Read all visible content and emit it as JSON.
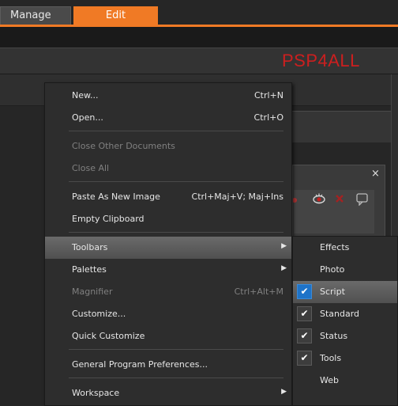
{
  "tabs": [
    {
      "label": "Manage",
      "active": false
    },
    {
      "label": "Edit",
      "active": true
    }
  ],
  "watermark": "PSP4ALL",
  "palette": {
    "close": "×",
    "icons": [
      "red-eye-icon",
      "delete-icon",
      "comment-icon"
    ]
  },
  "menu": {
    "items": [
      {
        "label": "New...",
        "shortcut": "Ctrl+N",
        "disabled": false
      },
      {
        "label": "Open...",
        "shortcut": "Ctrl+O",
        "disabled": false
      },
      {
        "label": "Close Other Documents",
        "shortcut": "",
        "disabled": true
      },
      {
        "label": "Close All",
        "shortcut": "",
        "disabled": true
      },
      {
        "label": "Paste As New Image",
        "shortcut": "Ctrl+Maj+V; Maj+Ins",
        "disabled": false
      },
      {
        "label": "Empty Clipboard",
        "shortcut": "",
        "disabled": false
      },
      {
        "label": "Toolbars",
        "shortcut": "",
        "disabled": false,
        "submenu": true,
        "highlighted": true
      },
      {
        "label": "Palettes",
        "shortcut": "",
        "disabled": false,
        "submenu": true
      },
      {
        "label": "Magnifier",
        "shortcut": "Ctrl+Alt+M",
        "disabled": true
      },
      {
        "label": "Customize...",
        "shortcut": "",
        "disabled": false
      },
      {
        "label": "Quick Customize",
        "shortcut": "",
        "disabled": false
      },
      {
        "label": "General Program Preferences...",
        "shortcut": "",
        "disabled": false
      },
      {
        "label": "Workspace",
        "shortcut": "",
        "disabled": false,
        "submenu": true
      }
    ],
    "arrow": "▶"
  },
  "submenu": {
    "check_glyph": "✔",
    "items": [
      {
        "label": "Effects",
        "checked": false
      },
      {
        "label": "Photo",
        "checked": false
      },
      {
        "label": "Script",
        "checked": true,
        "highlighted": true
      },
      {
        "label": "Standard",
        "checked": true
      },
      {
        "label": "Status",
        "checked": true
      },
      {
        "label": "Tools",
        "checked": true
      },
      {
        "label": "Web",
        "checked": false
      }
    ]
  },
  "colors": {
    "accent": "#f07a25",
    "watermark": "#cc1f1f",
    "check_highlight": "#1e73c8"
  }
}
